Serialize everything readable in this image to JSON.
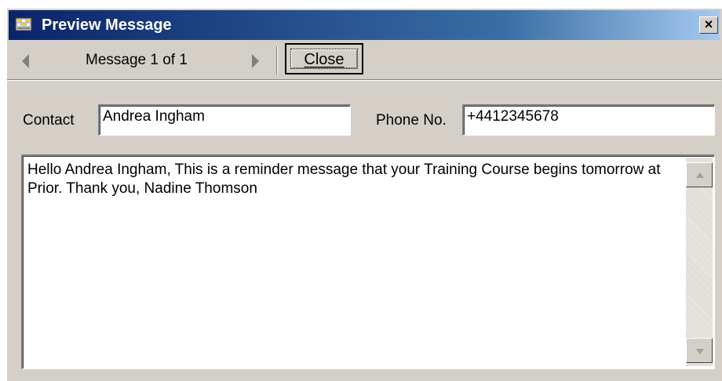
{
  "window": {
    "title": "Preview Message",
    "close_glyph": "×",
    "title_icon": "app-grid-icon"
  },
  "toolbar": {
    "prev_icon": "arrow-left-icon",
    "next_icon": "arrow-right-icon",
    "message_counter": "Message 1 of 1",
    "close_label": "Close"
  },
  "form": {
    "contact_label": "Contact",
    "contact_value": "Andrea Ingham",
    "phone_label": "Phone No.",
    "phone_value": "+4412345678"
  },
  "message": {
    "body": "Hello Andrea Ingham, This is a reminder message that your Training Course begins tomorrow at Prior. Thank you, Nadine Thomson"
  },
  "colors": {
    "title_start": "#0a246a",
    "title_end": "#a6caf0",
    "face": "#d4d0c8"
  }
}
